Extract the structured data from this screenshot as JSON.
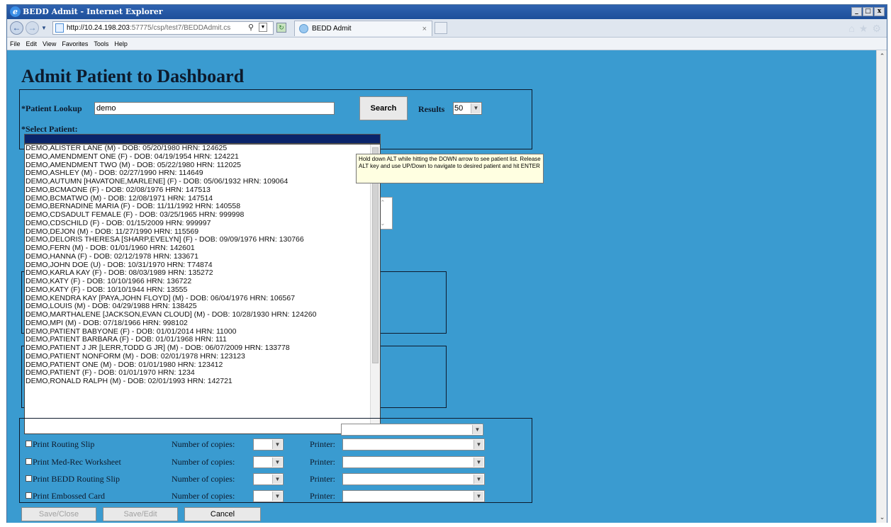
{
  "window": {
    "title": "BEDD Admit - Internet Explorer",
    "controls": [
      "_",
      "□",
      "x"
    ]
  },
  "browser": {
    "url_host": "http://10.24.198.203",
    "url_path": ":57775/csp/test7/BEDDAdmit.cs",
    "tab_title": "BEDD Admit",
    "tab_close": "×",
    "menu": [
      "File",
      "Edit",
      "View",
      "Favorites",
      "Tools",
      "Help"
    ]
  },
  "page": {
    "title": "Admit Patient to Dashboard",
    "patient_lookup_label": "*Patient Lookup",
    "patient_lookup_value": "demo",
    "search_button": "Search",
    "results_label": "Results",
    "results_value": "50",
    "select_patient_label": "*Select Patient:",
    "tooltip": "Hold down ALT while hitting the DOWN arrow to see patient list. Release ALT key and use UP/Down to navigate to desired patient and hit ENTER",
    "patients": [
      "DEMO,ALISTER LANE (M) - DOB: 05/20/1980 HRN: 124625",
      "DEMO,AMENDMENT ONE (F) - DOB: 04/19/1954 HRN: 124221",
      "DEMO,AMENDMENT TWO (M) - DOB: 05/22/1980 HRN: 112025",
      "DEMO,ASHLEY (M) - DOB: 02/27/1990 HRN: 114649",
      "DEMO,AUTUMN [HAVATONE,MARLENE] (F) - DOB: 05/06/1932 HRN: 109064",
      "DEMO,BCMAONE (F) - DOB: 02/08/1976 HRN: 147513",
      "DEMO,BCMATWO (M) - DOB: 12/08/1971 HRN: 147514",
      "DEMO,BERNADINE MARIA (F) - DOB: 11/11/1992 HRN: 140558",
      "DEMO,CDSADULT FEMALE (F) - DOB: 03/25/1965 HRN: 999998",
      "DEMO,CDSCHILD (F) - DOB: 01/15/2009 HRN: 999997",
      "DEMO,DEJON (M) - DOB: 11/27/1990 HRN: 115569",
      "DEMO,DELORIS THERESA [SHARP,EVELYN] (F) - DOB: 09/09/1976 HRN: 130766",
      "DEMO,FERN (M) - DOB: 01/01/1960 HRN: 142601",
      "DEMO,HANNA (F) - DOB: 02/12/1978 HRN: 133671",
      "DEMO,JOHN DOE (U) - DOB: 10/31/1970 HRN: T74874",
      "DEMO,KARLA KAY (F) - DOB: 08/03/1989 HRN: 135272",
      "DEMO,KATY (F) - DOB: 10/10/1966 HRN: 136722",
      "DEMO,KATY (F) - DOB: 10/10/1944 HRN: 13555",
      "DEMO,KENDRA KAY [PAYA,JOHN FLOYD] (M) - DOB: 06/04/1976 HRN: 106567",
      "DEMO,LOUIS (M) - DOB: 04/29/1988 HRN: 138425",
      "DEMO,MARTHALENE [JACKSON,EVAN CLOUD] (M) - DOB: 10/28/1930 HRN: 124260",
      "DEMO,MPI (M) - DOB: 07/18/1966 HRN: 998102",
      "DEMO,PATIENT BABYONE (F) - DOB: 01/01/2014 HRN: 11000",
      "DEMO,PATIENT BARBARA (F) - DOB: 01/01/1968 HRN: 111",
      "DEMO,PATIENT J JR [LERR,TODD G JR] (M) - DOB: 06/07/2009 HRN: 133778",
      "DEMO,PATIENT NONFORM (M) - DOB: 02/01/1978 HRN: 123123",
      "DEMO,PATIENT ONE (M) - DOB: 01/01/1980 HRN: 123412",
      "DEMO,PATIENT (F) - DOB: 01/01/1970 HRN: 1234",
      "DEMO,RONALD RALPH (M) - DOB: 02/01/1993 HRN: 142721"
    ],
    "print_rows": [
      {
        "label": "Print Routing Slip",
        "copies_label": "Number of copies:",
        "printer_label": "Printer:"
      },
      {
        "label": "Print Med-Rec Worksheet",
        "copies_label": "Number of copies:",
        "printer_label": "Printer:"
      },
      {
        "label": "Print BEDD Routing Slip",
        "copies_label": "Number of copies:",
        "printer_label": "Printer:"
      },
      {
        "label": "Print Embossed Card",
        "copies_label": "Number of copies:",
        "printer_label": "Printer:"
      }
    ],
    "buttons": {
      "save_close": "Save/Close",
      "save_edit": "Save/Edit",
      "cancel": "Cancel"
    }
  }
}
